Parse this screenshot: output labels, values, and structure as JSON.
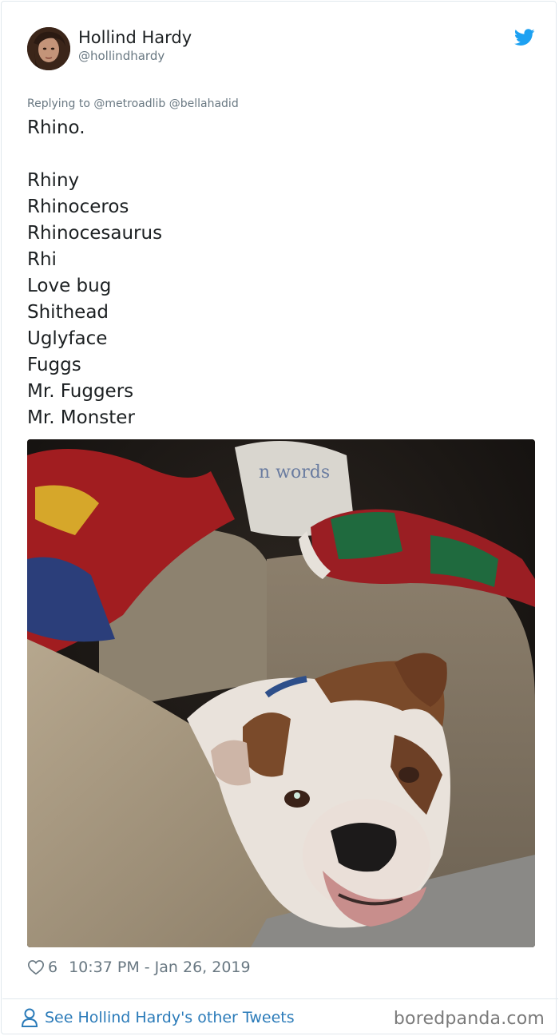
{
  "tweet": {
    "author": {
      "display_name": "Hollind Hardy",
      "handle": "@hollindhardy"
    },
    "replying_to": {
      "prefix": "Replying to ",
      "mentions": [
        "@metroadlib",
        "@bellahadid"
      ]
    },
    "text_lines": [
      "Rhino.",
      "",
      "Rhiny",
      "Rhinoceros",
      "Rhinocesaurus",
      "Rhi",
      "Love bug",
      "Shithead",
      "Uglyface",
      "Fuggs",
      "Mr. Fuggers",
      "Mr. Monster"
    ],
    "media": {
      "pillow_text": "n words"
    },
    "likes": "6",
    "timestamp": "10:37 PM - Jan 26, 2019"
  },
  "footer": {
    "cta_label": "See Hollind Hardy's other Tweets",
    "watermark": "boredpanda.com"
  },
  "icons": {
    "brand": "twitter-bird-icon",
    "like": "heart-icon",
    "profile": "person-icon"
  },
  "colors": {
    "twitter_blue": "#1da1f2",
    "link": "#2b7bb9",
    "muted": "#697882"
  }
}
